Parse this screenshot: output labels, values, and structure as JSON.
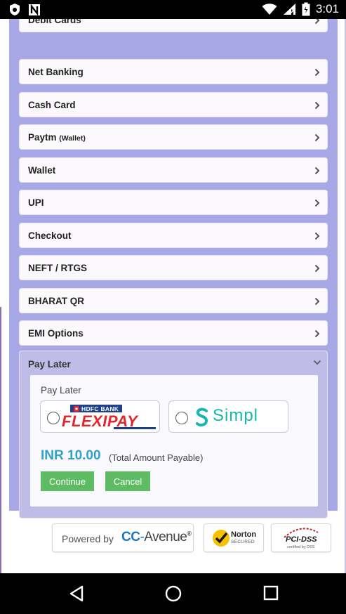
{
  "status_bar": {
    "time": "3:01",
    "icons": [
      "shield-icon",
      "n-logo-icon",
      "wifi-icon",
      "signal-icon",
      "battery-icon"
    ]
  },
  "payment_methods": [
    {
      "label": "Debit Cards",
      "sub": ""
    },
    {
      "label": "Net Banking",
      "sub": ""
    },
    {
      "label": "Cash Card",
      "sub": ""
    },
    {
      "label": "Paytm",
      "sub": "(Wallet)"
    },
    {
      "label": "Wallet",
      "sub": ""
    },
    {
      "label": "UPI",
      "sub": ""
    },
    {
      "label": "Checkout",
      "sub": ""
    },
    {
      "label": "NEFT / RTGS",
      "sub": ""
    },
    {
      "label": "BHARAT QR",
      "sub": ""
    },
    {
      "label": "EMI Options",
      "sub": ""
    }
  ],
  "pay_later": {
    "header": "Pay Later",
    "label": "Pay Later",
    "options": [
      {
        "bank_text": "HDFC BANK",
        "brand_text": "FLEXIPAY"
      },
      {
        "brand_text": "Simpl"
      }
    ],
    "amount": "INR 10.00",
    "amount_note": "(Total Amount Payable)",
    "continue_label": "Continue",
    "cancel_label": "Cancel"
  },
  "footer": {
    "powered_by": "Powered by",
    "brand": "CC",
    "brand_rest": "Avenue",
    "reg": "®",
    "norton": "Norton",
    "norton_sub": "SECURED",
    "pci": "PCI-DSS",
    "pci_sub": "certified by DSS"
  },
  "colors": {
    "panel": "#a9a8e6",
    "accent_blue": "#2fa3c7",
    "button_green": "#5dbb63",
    "flexipay_red": "#e3262d",
    "hdfc_blue": "#1d3f8c",
    "simpl_teal": "#17b6b0"
  }
}
